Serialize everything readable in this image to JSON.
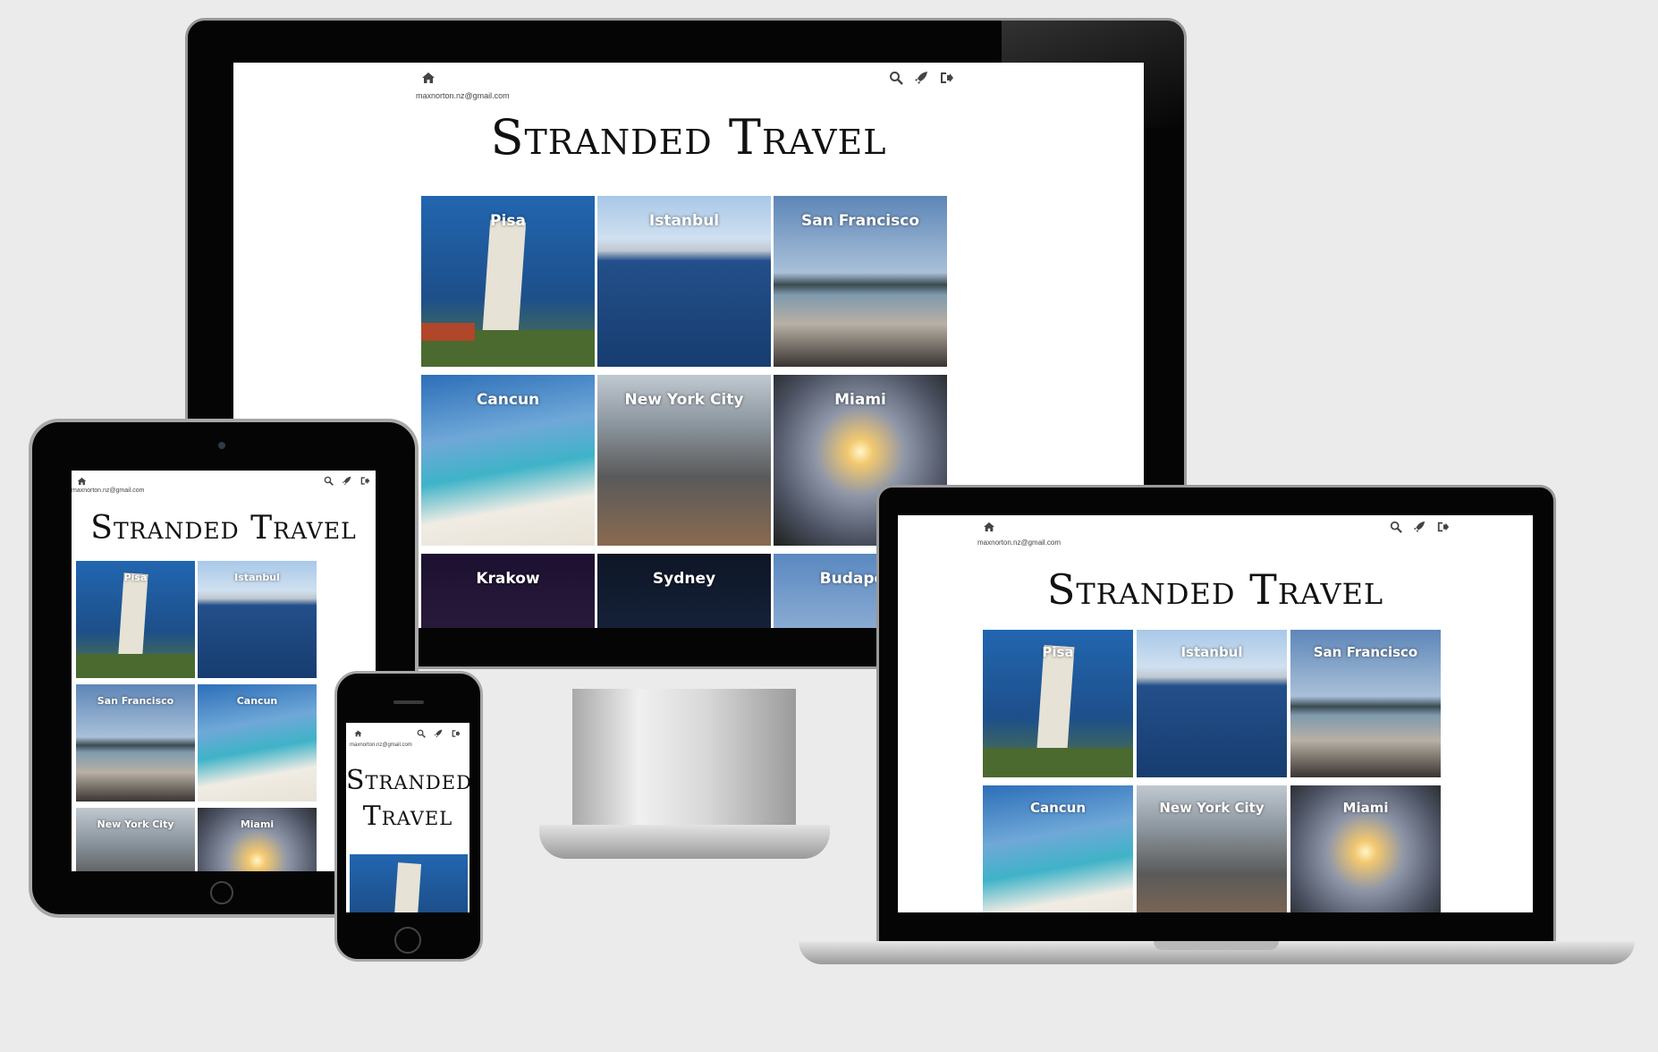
{
  "site": {
    "title": "Stranded Travel",
    "title_phone_line1": "Stranded",
    "title_phone_line2": "Travel",
    "email": "maxnorton.nz@gmail.com",
    "nav_icons": [
      "home-icon",
      "search-icon",
      "rocket-icon",
      "sign-out-icon"
    ]
  },
  "cities": [
    {
      "name": "Pisa",
      "bg": "#1f5fa0"
    },
    {
      "name": "Istanbul",
      "bg": "#1e4e8c"
    },
    {
      "name": "San Francisco",
      "bg": "#5b7aa0"
    },
    {
      "name": "Cancun",
      "bg": "#3f8fbf"
    },
    {
      "name": "New York City",
      "bg": "#7b8a95"
    },
    {
      "name": "Miami",
      "bg": "#6b6a66"
    },
    {
      "name": "Krakow",
      "bg": "#2a1838"
    },
    {
      "name": "Sydney",
      "bg": "#1a2433"
    },
    {
      "name": "Budapest",
      "bg": "#8aa8c8"
    }
  ],
  "colors": {
    "bezel": "#050505",
    "stand": "#c8c8c8",
    "page": "#ffffff",
    "background": "#ebebeb"
  }
}
